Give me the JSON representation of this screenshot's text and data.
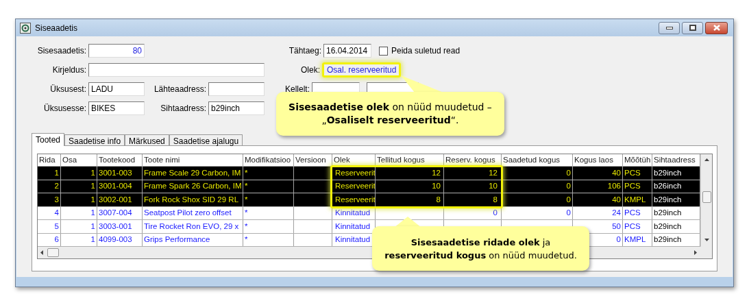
{
  "window": {
    "title": "Siseaadetis"
  },
  "form": {
    "sisesaadetis": {
      "label": "Sisesaadetis:",
      "value": "80"
    },
    "kirjeldus": {
      "label": "Kirjeldus:"
    },
    "uksusest": {
      "label": "Üksusest:",
      "value": "LADU"
    },
    "uksusesse": {
      "label": "Üksusesse:",
      "value": "BIKES"
    },
    "lahteaadress": {
      "label": "Lähteaadress:"
    },
    "sihtaadress": {
      "label": "Sihtaadress:",
      "value": "b29inch"
    },
    "tahtaeg": {
      "label": "Tähtaeg:",
      "value": "16.04.2014"
    },
    "hide_closed": {
      "label": "Peida suletud read",
      "checked": false
    },
    "olek": {
      "label": "Olek:",
      "value": "Osal. reserveeritud"
    },
    "kellelt": {
      "label": "Kellelt:"
    }
  },
  "tabs": [
    {
      "label": "Tooted",
      "selected": true
    },
    {
      "label": "Saadetise info",
      "selected": false
    },
    {
      "label": "Märkused",
      "selected": false
    },
    {
      "label": "Saadetise ajalugu",
      "selected": false
    }
  ],
  "table": {
    "columns": [
      "Rida",
      "Osa",
      "Tootekood",
      "Toote nimi",
      "Modifikatsioo",
      "Versioon",
      "Olek",
      "Tellitud kogus",
      "Reserv. kogus",
      "Saadetud kogus",
      "Kogus laos",
      "Mõõtüh",
      "Sihtaadress"
    ],
    "rows": [
      {
        "selected": true,
        "cells": [
          "1",
          "1",
          "3001-003",
          "Frame Scale 29 Carbon, IM",
          "*",
          null,
          "Reserveerit",
          "12",
          "12",
          "0",
          "40",
          "PCS",
          "b29inch"
        ]
      },
      {
        "selected": true,
        "cells": [
          "2",
          "1",
          "3001-004",
          "Frame Spark 26 Carbon, IM",
          "*",
          null,
          "Reserveerit",
          "10",
          "10",
          "0",
          "106",
          "PCS",
          "b26inch"
        ]
      },
      {
        "selected": true,
        "cells": [
          "3",
          "1",
          "3002-001",
          "Fork Rock Shox SID 29 RL",
          "*",
          null,
          "Reserveerit",
          "8",
          "8",
          "0",
          "40",
          "KMPL",
          "b29inch"
        ]
      },
      {
        "selected": false,
        "cells": [
          "4",
          "1",
          "3007-004",
          "Seatpost Pilot zero offset",
          "*",
          null,
          "Kinnitatud",
          null,
          "0",
          "0",
          "24",
          "PCS",
          "b29inch"
        ]
      },
      {
        "selected": false,
        "cells": [
          "5",
          "1",
          "3003-001",
          "Tire Rocket Ron EVO, 29 x",
          "*",
          null,
          "Kinnitatud",
          null,
          null,
          null,
          "50",
          "PCS",
          "b29inch"
        ]
      },
      {
        "selected": false,
        "cells": [
          "6",
          "1",
          "4099-003",
          "Grips Performance",
          "*",
          null,
          "Kinnitatud",
          null,
          null,
          null,
          "0",
          "KMPL",
          "b29inch"
        ]
      }
    ]
  },
  "callouts": [
    {
      "text": "**Sisesaadetise olek** on nüüd muudetud –\n„**Osaliselt reserveeritud**“."
    },
    {
      "text": "**Sisesaadetise ridade olek** ja **reserveeritud kogus** on nüüd muudetud."
    }
  ]
}
